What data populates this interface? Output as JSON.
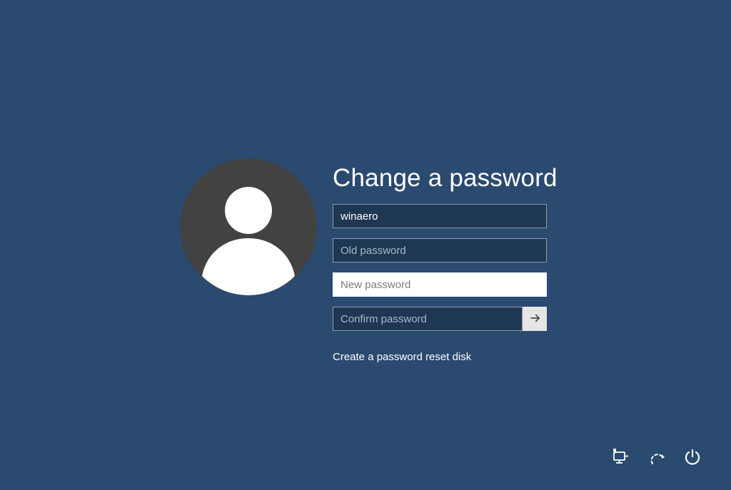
{
  "title": "Change a password",
  "fields": {
    "username": {
      "value": "winaero"
    },
    "old_password": {
      "placeholder": "Old password"
    },
    "new_password": {
      "placeholder": "New password"
    },
    "confirm_password": {
      "placeholder": "Confirm password"
    }
  },
  "links": {
    "reset_disk": "Create a password reset disk"
  }
}
